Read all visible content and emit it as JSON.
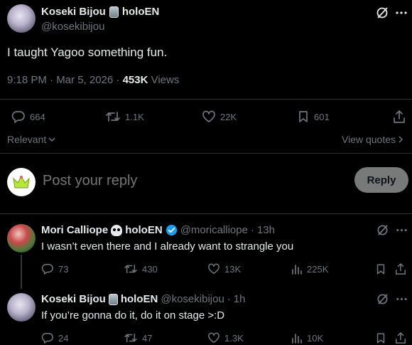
{
  "main_post": {
    "author_name": "Koseki Bijou",
    "author_org": "holoEN",
    "handle": "@kosekibijou",
    "text": "I taught Yagoo something fun.",
    "time": "9:18 PM · Mar 5, 2026 · ",
    "views_count": "453K",
    "views_label": " Views",
    "stats": {
      "replies": "664",
      "reposts": "1.1K",
      "likes": "22K",
      "bookmarks": "601"
    }
  },
  "filters": {
    "sort": "Relevant",
    "view_quotes": "View quotes"
  },
  "composer": {
    "placeholder": "Post your reply",
    "reply_label": "Reply"
  },
  "replies": [
    {
      "author_name": "Mori Calliope",
      "author_org": "holoEN",
      "handle": "@moricalliope",
      "age": "13h",
      "text": "I wasn’t even there and I already want to strangle you",
      "stats": {
        "replies": "73",
        "reposts": "430",
        "likes": "13K",
        "views": "225K"
      }
    },
    {
      "author_name": "Koseki Bijou",
      "author_org": "holoEN",
      "handle": "@kosekibijou",
      "age": "1h",
      "text": "If you’re gonna do it, do it on stage >:D",
      "stats": {
        "replies": "24",
        "reposts": "47",
        "likes": "1.3K",
        "views": "10K"
      }
    }
  ],
  "colors": {
    "background": "#000000",
    "text": "#e7e9ea",
    "muted": "#71767b",
    "verified": "#1d9bf0",
    "divider": "#2f3336"
  }
}
